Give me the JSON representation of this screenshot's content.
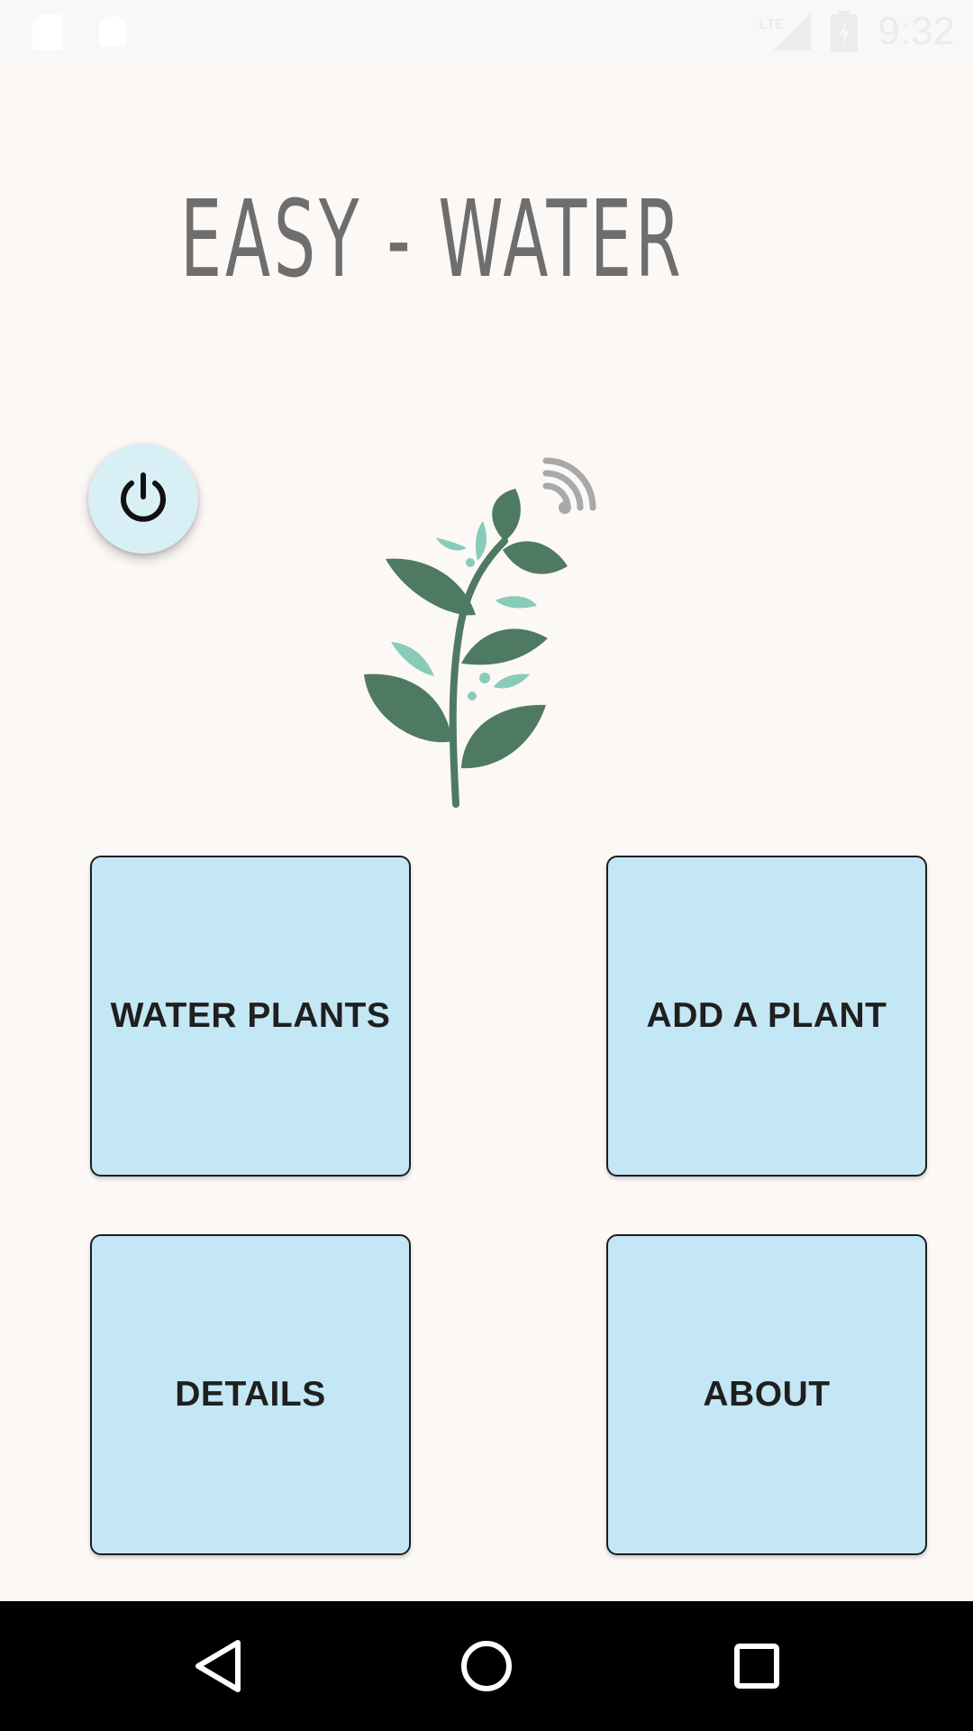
{
  "status_bar": {
    "time": "9:32",
    "network": "LTE",
    "icons": [
      "sd-card-icon",
      "android-icon",
      "signal-icon",
      "battery-icon"
    ]
  },
  "app": {
    "title": "EASY - WATER"
  },
  "power": {
    "icon": "power-icon"
  },
  "logo": {
    "icon": "plant-wifi-icon"
  },
  "buttons": {
    "water_plants": "WATER PLANTS",
    "add_plant": "ADD A PLANT",
    "details": "DETAILS",
    "about": "ABOUT"
  },
  "nav": {
    "icons": [
      "back-icon",
      "home-icon",
      "recents-icon"
    ]
  },
  "colors": {
    "background": "#fcf8f6",
    "tile": "#c3e7f5",
    "fab": "#d9eff6",
    "plant_dark": "#4f7a62",
    "plant_light": "#88cbb9",
    "title": "#6e6e6e"
  }
}
